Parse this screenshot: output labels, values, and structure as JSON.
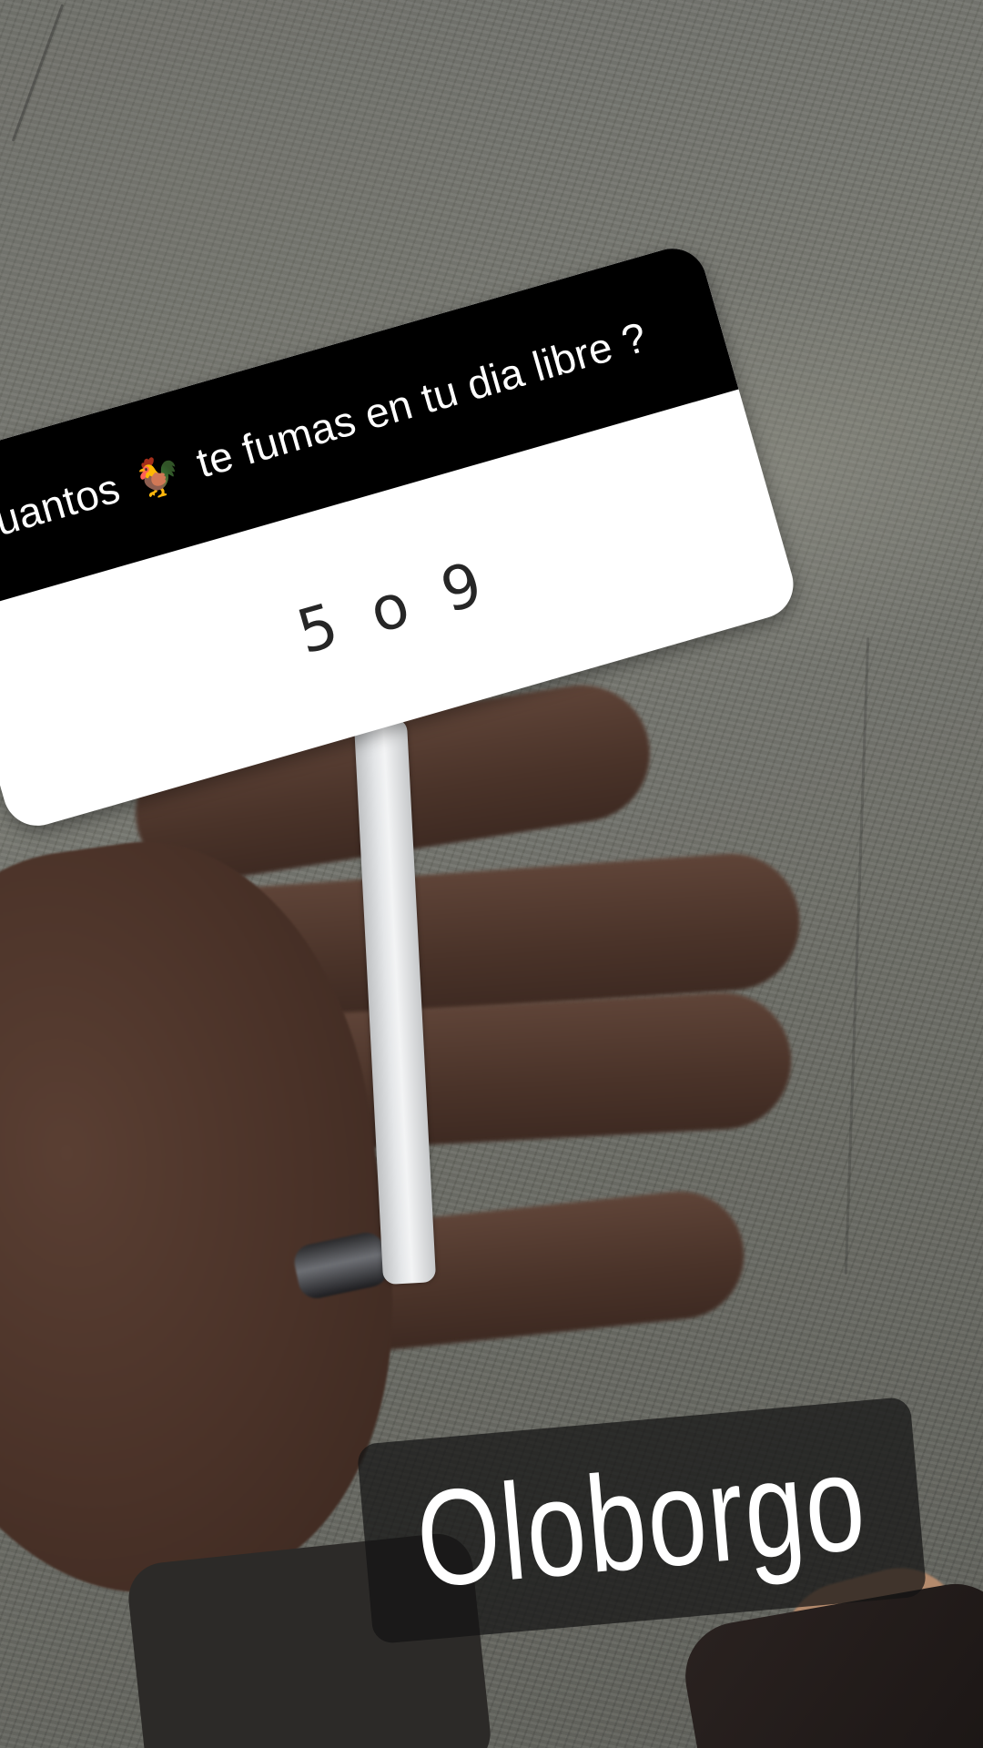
{
  "question_sticker": {
    "question_before": "cuantos",
    "emoji": "🐓",
    "question_after": "te fumas en tu dia libre ?",
    "answer": "5 o 9",
    "header_color": "#000000",
    "body_color": "#ffffff"
  },
  "caption": {
    "text": "Oloborgo"
  }
}
